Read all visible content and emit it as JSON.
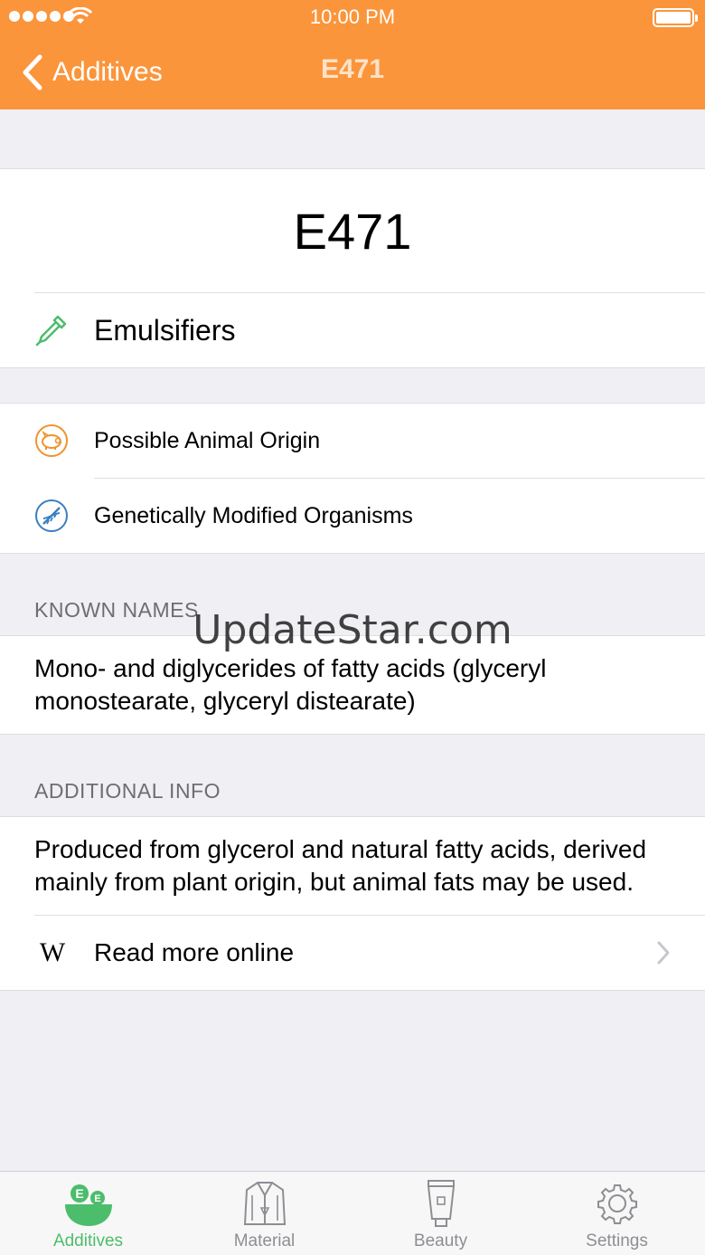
{
  "status": {
    "time": "10:00 PM"
  },
  "nav": {
    "back_label": "Additives",
    "title": "E471"
  },
  "additive": {
    "code": "E471",
    "category": "Emulsifiers",
    "flags": [
      "Possible Animal Origin",
      "Genetically Modified Organisms"
    ]
  },
  "known_names": {
    "header": "KNOWN NAMES",
    "text": "Mono- and diglycerides of fatty acids (glyceryl monostearate, glyceryl distearate)"
  },
  "additional_info": {
    "header": "ADDITIONAL INFO",
    "text": "Produced from glycerol and natural fatty acids, derived mainly from plant origin, but animal fats may be used."
  },
  "read_more": {
    "label": "Read more online",
    "icon_text": "W"
  },
  "watermark": "UpdateStar.com",
  "tabs": [
    {
      "label": "Additives",
      "icon": "additives-bowl-icon",
      "active": true
    },
    {
      "label": "Material",
      "icon": "jacket-icon",
      "active": false
    },
    {
      "label": "Beauty",
      "icon": "cream-tube-icon",
      "active": false
    },
    {
      "label": "Settings",
      "icon": "gear-icon",
      "active": false
    }
  ],
  "colors": {
    "accent": "#fb953b",
    "active_tab": "#4cbd6b",
    "dropper": "#4cbd6b",
    "animal": "#f0932d",
    "gmo": "#3a7fbf"
  }
}
